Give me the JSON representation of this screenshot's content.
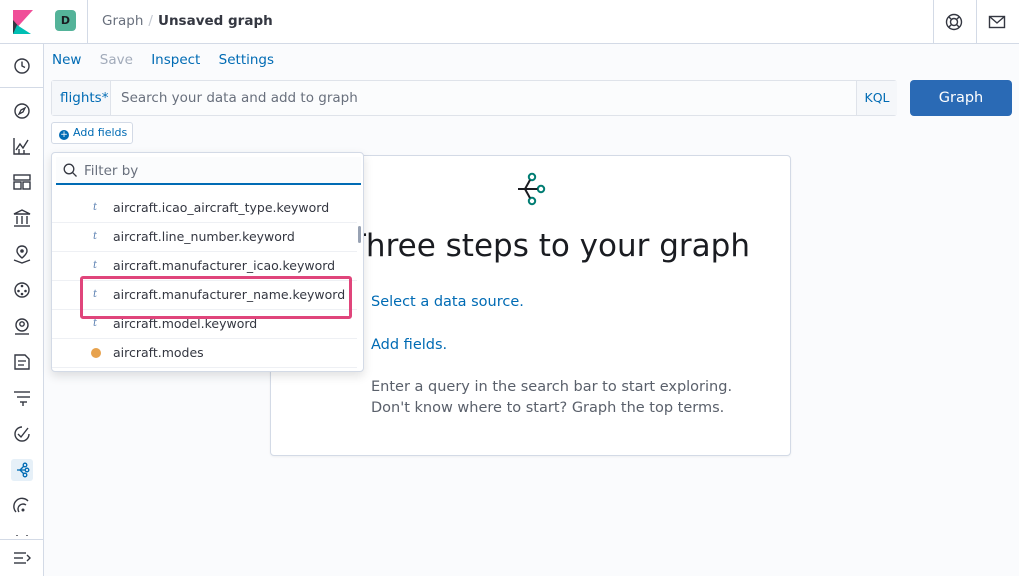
{
  "header": {
    "avatar_letter": "D",
    "breadcrumbs": [
      "Graph",
      "Unsaved graph"
    ],
    "breadcrumb_separator": "/"
  },
  "menu": {
    "new_label": "New",
    "save_label": "Save",
    "inspect_label": "Inspect",
    "settings_label": "Settings"
  },
  "search": {
    "index_label": "flights*",
    "placeholder": "Search your data and add to graph",
    "language_label": "KQL",
    "submit_label": "Graph"
  },
  "add_fields_label": "Add fields",
  "field_picker": {
    "filter_placeholder": "Filter by",
    "fields": [
      {
        "type": "t",
        "name": "aircraft.icao_aircraft_type.keyword"
      },
      {
        "type": "t",
        "name": "aircraft.line_number.keyword"
      },
      {
        "type": "t",
        "name": "aircraft.manufacturer_icao.keyword"
      },
      {
        "type": "t",
        "name": "aircraft.manufacturer_name.keyword"
      },
      {
        "type": "t",
        "name": "aircraft.model.keyword"
      },
      {
        "type": "geo",
        "name": "aircraft.modes"
      }
    ]
  },
  "guidance": {
    "title": "Three steps to your graph",
    "step1": "Select a data source.",
    "step2": "Add fields.",
    "step3_line1": "Enter a query in the search bar to start exploring.",
    "step3_line2": "Don't know where to start? Graph the top terms."
  },
  "colors": {
    "accent": "#006bb4",
    "primary_button": "#2a6ab5",
    "highlight": "#e0457b"
  },
  "icons": {
    "logo": "kibana-logo-icon",
    "help": "help-lifebuoy-icon",
    "mail": "mail-icon"
  }
}
